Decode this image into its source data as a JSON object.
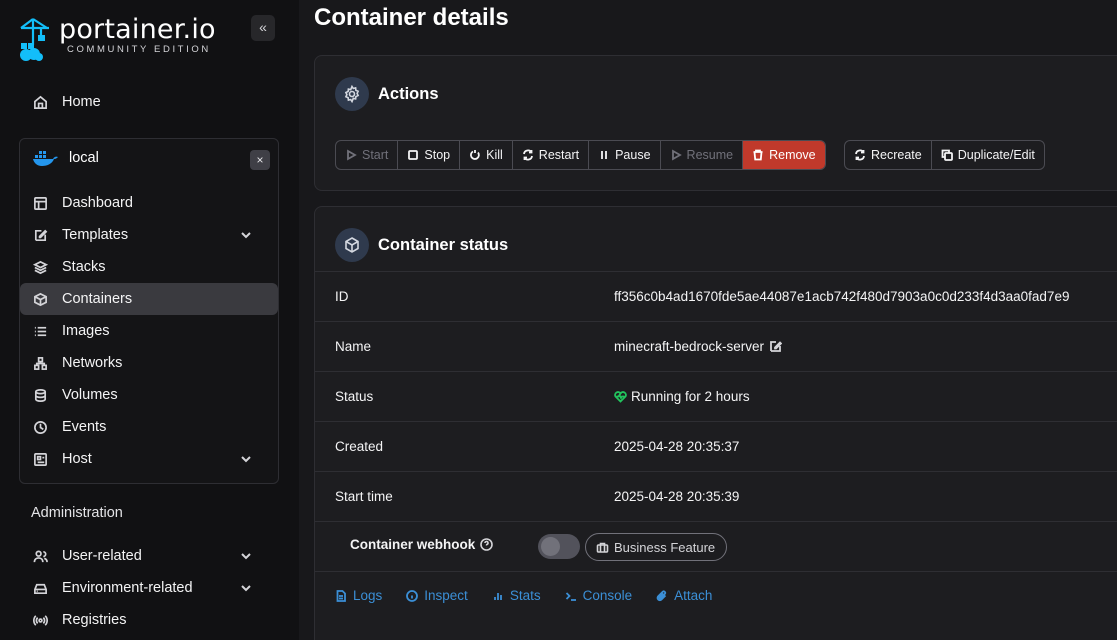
{
  "brand": {
    "name": "portainer.io",
    "edition": "COMMUNITY EDITION"
  },
  "sidebar": {
    "collapse": "«",
    "home": "Home",
    "environment": {
      "name": "local",
      "close": "×"
    },
    "env_items": [
      {
        "label": "Dashboard",
        "icon": "dashboard-icon"
      },
      {
        "label": "Templates",
        "icon": "edit-icon",
        "expandable": true
      },
      {
        "label": "Stacks",
        "icon": "layers-icon"
      },
      {
        "label": "Containers",
        "icon": "box-icon",
        "active": true
      },
      {
        "label": "Images",
        "icon": "list-icon"
      },
      {
        "label": "Networks",
        "icon": "network-icon"
      },
      {
        "label": "Volumes",
        "icon": "database-icon"
      },
      {
        "label": "Events",
        "icon": "clock-icon"
      },
      {
        "label": "Host",
        "icon": "host-icon",
        "expandable": true
      }
    ],
    "admin_title": "Administration",
    "admin_items": [
      {
        "label": "User-related",
        "icon": "users-icon",
        "expandable": true
      },
      {
        "label": "Environment-related",
        "icon": "drive-icon",
        "expandable": true
      },
      {
        "label": "Registries",
        "icon": "radio-icon"
      }
    ]
  },
  "page": {
    "title": "Container details"
  },
  "actions": {
    "title": "Actions",
    "group1": [
      {
        "label": "Start",
        "state": "disabled",
        "icon": "play-icon"
      },
      {
        "label": "Stop",
        "state": "normal",
        "icon": "stop-icon"
      },
      {
        "label": "Kill",
        "state": "normal",
        "icon": "kill-icon"
      },
      {
        "label": "Restart",
        "state": "normal",
        "icon": "restart-icon"
      },
      {
        "label": "Pause",
        "state": "normal",
        "icon": "pause-icon"
      },
      {
        "label": "Resume",
        "state": "disabled",
        "icon": "play-icon"
      },
      {
        "label": "Remove",
        "state": "danger",
        "icon": "trash-icon"
      }
    ],
    "group2": [
      {
        "label": "Recreate",
        "icon": "restart-icon"
      },
      {
        "label": "Duplicate/Edit",
        "icon": "copy-icon"
      }
    ],
    "colors": {
      "danger": "#c0392b",
      "link": "#3b8fd6",
      "status_ok": "#22c55e"
    }
  },
  "status": {
    "title": "Container status",
    "rows": [
      {
        "key": "ID",
        "value": "ff356c0b4ad1670fde5ae44087e1acb742f480d7903a0c0d233f4d3aa0fad7e9"
      },
      {
        "key": "Name",
        "value": "minecraft-bedrock-server"
      },
      {
        "key": "Status",
        "value": "Running for 2 hours"
      },
      {
        "key": "Created",
        "value": "2025-04-28 20:35:37"
      },
      {
        "key": "Start time",
        "value": "2025-04-28 20:35:39"
      }
    ],
    "webhook_label": "Container webhook",
    "business_feature": "Business Feature",
    "links": [
      {
        "label": "Logs",
        "icon": "file-icon"
      },
      {
        "label": "Inspect",
        "icon": "info-icon"
      },
      {
        "label": "Stats",
        "icon": "stats-icon"
      },
      {
        "label": "Console",
        "icon": "terminal-icon"
      },
      {
        "label": "Attach",
        "icon": "paperclip-icon"
      }
    ]
  }
}
